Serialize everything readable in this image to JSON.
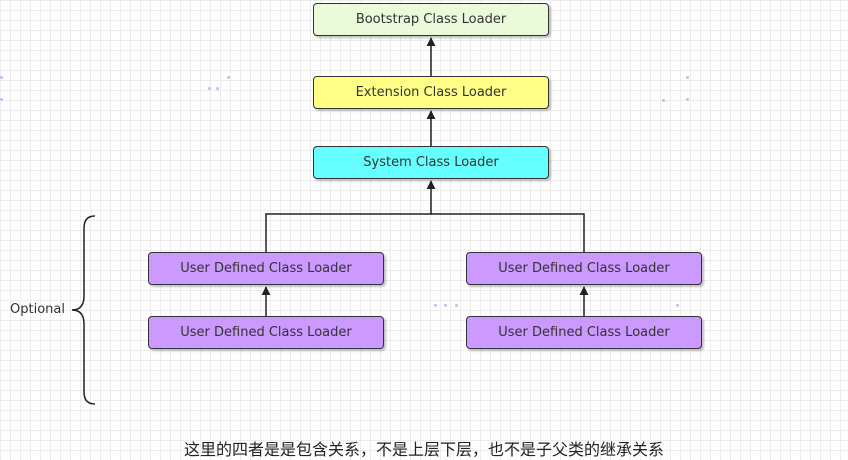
{
  "nodes": {
    "bootstrap": "Bootstrap Class Loader",
    "extension": "Extension Class Loader",
    "system": "System Class Loader",
    "user_left_top": "User Defined Class Loader",
    "user_left_bottom": "User Defined Class Loader",
    "user_right_top": "User Defined Class Loader",
    "user_right_bottom": "User Defined Class Loader"
  },
  "optional_label": "Optional",
  "caption": "这里的四者是是包含关系，不是上层下层，也不是子父类的继承关系",
  "colors": {
    "bootstrap_fill": "#ebfadb",
    "extension_fill": "#ffff88",
    "system_fill": "#66ffff",
    "user_fill": "#cc99ff",
    "stroke": "#333333"
  }
}
